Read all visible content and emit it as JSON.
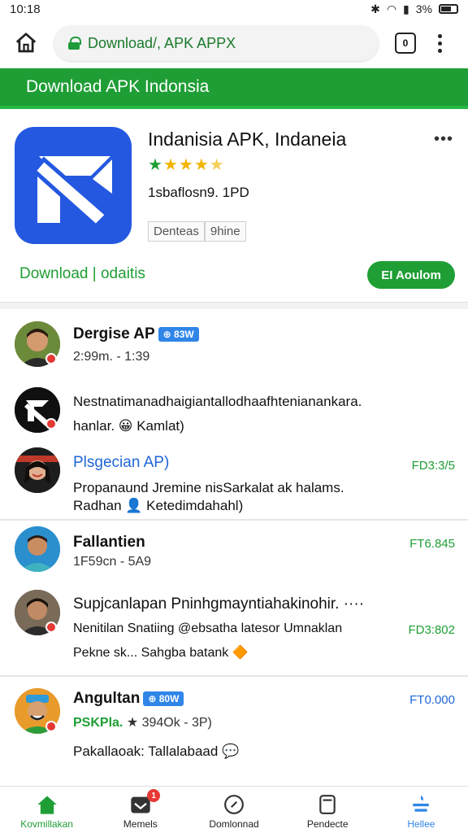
{
  "status_bar": {
    "time": "10:18",
    "battery": "3%"
  },
  "browser": {
    "url": "Download/, APK APPX",
    "tab_count": "0"
  },
  "site": {
    "header": "Download  APK Indonsia"
  },
  "app": {
    "title": "Indanisia APK, Indaneia",
    "rating": 4.5,
    "meta": "1sbaflosn9. 1PD",
    "chips": [
      "Denteas",
      "9hine"
    ],
    "download_link": "Download | odaitis",
    "download_button": "EI Aoulom",
    "icon_color": "#2458e0"
  },
  "feed": [
    {
      "name": "Dergise AP",
      "badge": "⊕ 83W",
      "sub": "2:99m. - 1:39"
    },
    {
      "text": "Nestnatimanadhaigiantallodhaafhtenianankara.",
      "text2": "hanlar. 😀 Kamlat)"
    },
    {
      "name": "Plsgecian AP)",
      "price": "FD3:3/5",
      "text": "Propanaund Jremine nisSarkalat ak halams.",
      "text2": "Radhan 👤 Ketedimdahahl)"
    },
    {
      "name": "Fallantien",
      "sub": "1F59cn - 5A9",
      "price": "FT6.845"
    },
    {
      "name": "Supjcanlapan Pninhgmayntiahakinohir. ····",
      "text": "Nenitilan Snatiing @ebsatha latesor Umnaklan",
      "price": "FD3:802",
      "text2": "Pekne sk... Sahgba batank 🔶"
    },
    {
      "name": "Angultan",
      "badge": "⊕ 80W",
      "sub_green": "PSKPla.",
      "sub": "★ 394Ok - 3P)",
      "price": "FT0.000",
      "text": "Pakallaoak: Tallalabaad 💬"
    }
  ],
  "nav": [
    {
      "label": "Kovmillakan",
      "icon": "home-icon"
    },
    {
      "label": "Memels",
      "icon": "inbox-icon",
      "badge": "1"
    },
    {
      "label": "Domlonnad",
      "icon": "compass-icon"
    },
    {
      "label": "Pendecte",
      "icon": "tablet-icon"
    },
    {
      "label": "Hellee",
      "icon": "tools-icon"
    }
  ],
  "colors": {
    "brand_green": "#1f9e35",
    "accent_blue": "#2f86e8",
    "app_blue": "#2458e0"
  }
}
